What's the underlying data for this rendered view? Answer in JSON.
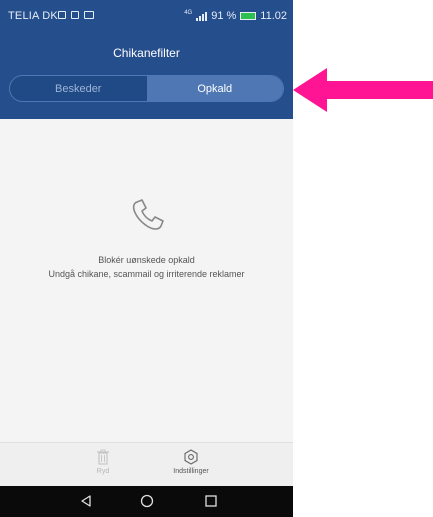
{
  "status_bar": {
    "carrier": "TELIA DK",
    "network": "4G",
    "battery": "91 %",
    "time": "11.02"
  },
  "header": {
    "title": "Chikanefilter"
  },
  "tabs": [
    {
      "label": "Beskeder",
      "active": false
    },
    {
      "label": "Opkald",
      "active": true
    }
  ],
  "empty_state": {
    "icon": "phone-icon",
    "title": "Blokér uønskede opkald",
    "subtitle": "Undgå chikane, scammail og irriterende reklamer"
  },
  "bottom_actions": [
    {
      "label": "Ryd",
      "icon": "trash-icon",
      "enabled": false
    },
    {
      "label": "Indstillinger",
      "icon": "settings-icon",
      "enabled": true
    }
  ],
  "nav": [
    "back-icon",
    "home-icon",
    "recents-icon"
  ],
  "colors": {
    "header": "#254e8c",
    "active_tab": "#4e77b3",
    "annotation_arrow": "#ff1493"
  }
}
